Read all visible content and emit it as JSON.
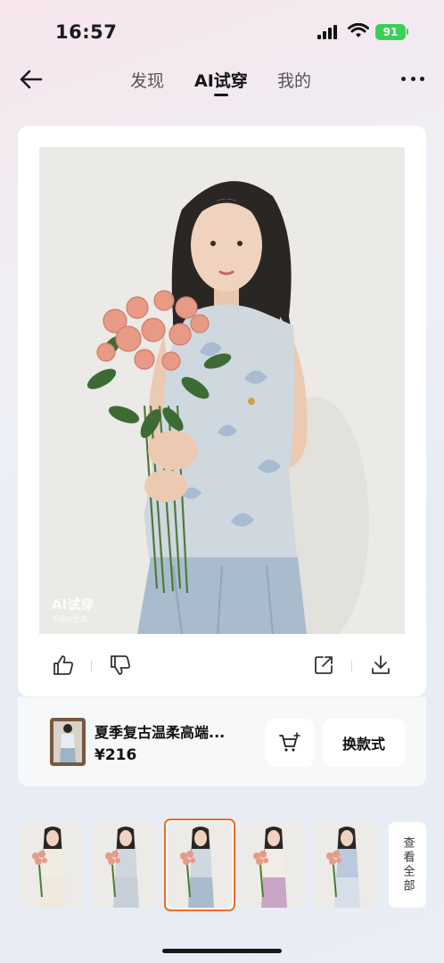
{
  "status_bar": {
    "time": "16:57",
    "battery": "91"
  },
  "nav": {
    "tabs": [
      {
        "label": "发现",
        "active": false
      },
      {
        "label": "AI试穿",
        "active": true
      },
      {
        "label": "我的",
        "active": false
      }
    ]
  },
  "photo": {
    "watermark_title": "AI试穿",
    "watermark_sub": "千问AI生成"
  },
  "product": {
    "title": "夏季复古温柔高端...",
    "price": "¥216",
    "swap_label": "换款式"
  },
  "strip": {
    "view_all_label": "查看全部",
    "selected_index": 2
  },
  "colors": {
    "accent": "#ef6a24",
    "battery": "#3ccf55"
  },
  "icons": [
    "back-arrow-icon",
    "more-icon",
    "thumbs-up-icon",
    "thumbs-down-icon",
    "share-icon",
    "download-icon",
    "cart-add-icon"
  ]
}
